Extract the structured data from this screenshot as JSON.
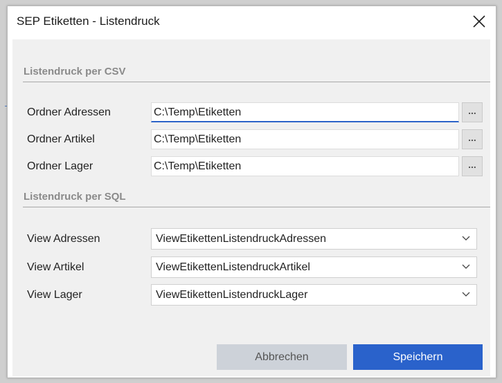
{
  "window": {
    "title": "SEP Etiketten - Listendruck"
  },
  "csv_section": {
    "heading": "Listendruck per CSV",
    "rows": [
      {
        "label": "Ordner Adressen",
        "value": "C:\\Temp\\Etiketten",
        "browse": "..."
      },
      {
        "label": "Ordner Artikel",
        "value": "C:\\Temp\\Etiketten",
        "browse": "..."
      },
      {
        "label": "Ordner Lager",
        "value": "C:\\Temp\\Etiketten",
        "browse": "..."
      }
    ]
  },
  "sql_section": {
    "heading": "Listendruck per SQL",
    "rows": [
      {
        "label": "View Adressen",
        "value": "ViewEtikettenListendruckAdressen"
      },
      {
        "label": "View Artikel",
        "value": "ViewEtikettenListendruckArtikel"
      },
      {
        "label": "View Lager",
        "value": "ViewEtikettenListendruckLager"
      }
    ]
  },
  "buttons": {
    "cancel": "Abbrechen",
    "save": "Speichern"
  },
  "colors": {
    "accent": "#2a62cb",
    "cancel_bg": "#cdd2d9",
    "content_bg": "#f0f0f0"
  }
}
